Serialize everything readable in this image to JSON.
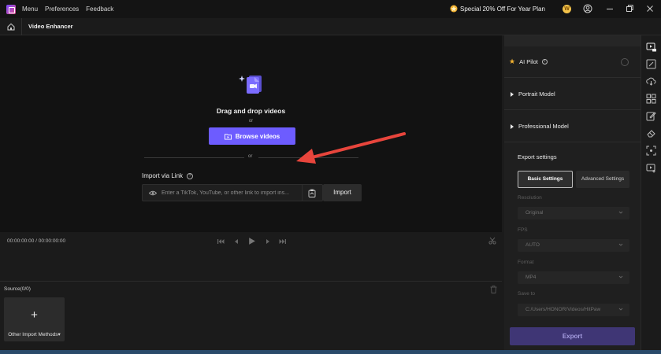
{
  "titlebar": {
    "menu": [
      "Menu",
      "Preferences",
      "Feedback"
    ],
    "promo": "Special 20% Off For Year Plan",
    "coin_label": "W"
  },
  "subbar": {
    "title": "Video Enhancer"
  },
  "preview": {
    "drag_text": "Drag and drop videos",
    "or_small": "or",
    "browse_label": "Browse videos",
    "or_mid": "or",
    "import_link_label": "Import via Link",
    "link_placeholder": "Enter a TikTok, YouTube, or other link to import ins...",
    "import_button": "Import"
  },
  "timeline": {
    "timecode": "00:00:00:00 / 00:00:00:00"
  },
  "source": {
    "label": "Source(0/0)",
    "tile_label": "Other Import Methods"
  },
  "right_panel": {
    "ai_pilot": "AI Pilot",
    "portrait_model": "Portrait Model",
    "professional_model": "Professional Model",
    "export_settings": "Export settings",
    "basic_settings": "Basic Settings",
    "advanced_settings": "Advanced Settings",
    "fields": [
      {
        "label": "Resolution",
        "value": "Original"
      },
      {
        "label": "FPS",
        "value": "AUTO"
      },
      {
        "label": "Format",
        "value": "MP4"
      },
      {
        "label": "Save to",
        "value": "C:/Users/HONOR/Videos/HitPaw"
      }
    ],
    "export_button": "Export"
  },
  "colors": {
    "accent": "#6d5cff",
    "export_disabled": "#3f3675",
    "arrow": "#e8453c",
    "promo_star": "#f3b230"
  }
}
